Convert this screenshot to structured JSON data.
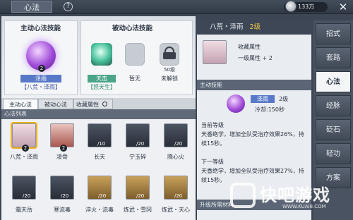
{
  "topbar": {
    "title": "心法",
    "help": "?",
    "currency": "133万",
    "close": "✕"
  },
  "left": {
    "active_header": "主动心法技能",
    "passive_header": "被动心法技能",
    "active_skill": {
      "level": "2",
      "name": "泽雨",
      "tag": "【八荒・泽雨】"
    },
    "passive_skills": [
      {
        "name": "天击",
        "tag": "【怒天生】"
      },
      {
        "name": "暂无",
        "tag": ""
      },
      {
        "name": "未解锁",
        "tag": "",
        "lock": "50级"
      }
    ],
    "tabs": [
      "主动心法",
      "被动心法",
      "收藏属性"
    ],
    "list_header": "心法列表",
    "items": [
      {
        "name": "八荒・泽雨",
        "badge": "2",
        "count": ""
      },
      {
        "name": "凌骨",
        "badge": "2",
        "count": ""
      },
      {
        "name": "长天",
        "badge": "",
        "count": "/10"
      },
      {
        "name": "宁玉碎",
        "badge": "",
        "count": "/20"
      },
      {
        "name": "隋心火",
        "badge": "",
        "count": "/20"
      },
      {
        "name": "霜天岳",
        "badge": "",
        "count": "/20"
      },
      {
        "name": "寒流毒",
        "badge": "",
        "count": "/20"
      },
      {
        "name": "淬火・流毒",
        "badge": "",
        "count": "/20"
      },
      {
        "name": "炼武・雪冈",
        "badge": "",
        "count": "/20"
      },
      {
        "name": "炼武・天心",
        "badge": "",
        "count": "/20"
      }
    ]
  },
  "right": {
    "title": "八荒・泽雨",
    "level": "2级",
    "collect_label": "收藏属性",
    "collect_value": "一级属性 + 2",
    "skill_header": "主动技能",
    "skill_name": "泽雨",
    "skill_level": "2级",
    "cooldown": "冷却:150秒",
    "cur_label": "当前等级",
    "cur_desc": "天香绝学，增加全队受治疗效果26%，持续15秒。",
    "next_label": "下一等级",
    "next_desc": "天香绝学，增加全队受治疗效果27%，持续15秒。",
    "upgrade": "升级所需材料"
  },
  "nav": [
    "招式",
    "套路",
    "心法",
    "经脉",
    "砭石",
    "轻功",
    "方案"
  ],
  "watermark": {
    "text": "快吧游戏",
    "url": "WWW.KUAI8.COM"
  }
}
